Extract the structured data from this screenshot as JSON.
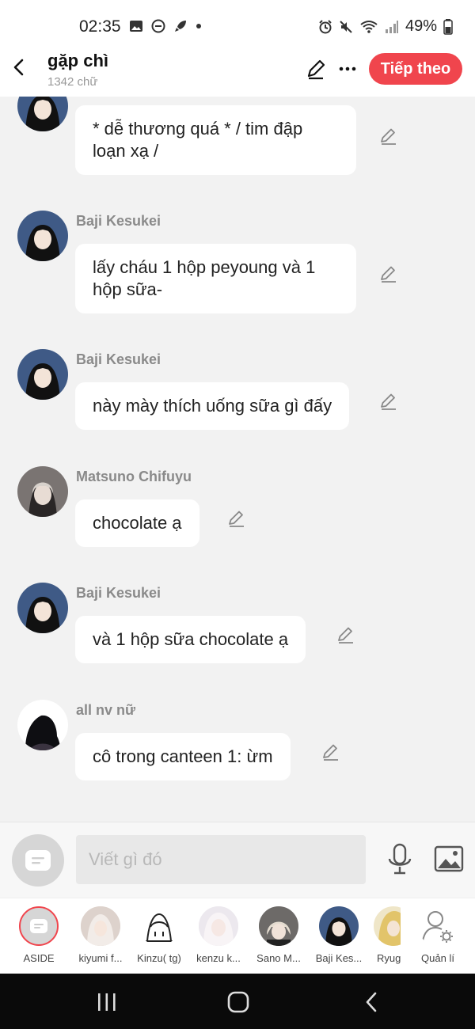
{
  "status_bar": {
    "time": "02:35",
    "battery": "49%"
  },
  "header": {
    "title": "gặp chì",
    "word_count": "1342 chữ",
    "next_label": "Tiếp theo"
  },
  "messages": [
    {
      "sender": "",
      "text": "* dễ thương quá * / tim đập loạn xạ /"
    },
    {
      "sender": "Baji Kesukei",
      "text": "lấy cháu 1 hộp peyoung và 1 hộp sữa-"
    },
    {
      "sender": "Baji Kesukei",
      "text": "này mày thích uống sữa gì đấy"
    },
    {
      "sender": "Matsuno Chifuyu",
      "text": "chocolate ạ"
    },
    {
      "sender": "Baji Kesukei",
      "text": "và 1 hộp sữa chocolate ạ"
    },
    {
      "sender": "all nv nữ",
      "text": "cô trong canteen 1: ừm"
    }
  ],
  "composer": {
    "placeholder": "Viết gì đó"
  },
  "characters": [
    {
      "label": "ASIDE"
    },
    {
      "label": "kiyumi f..."
    },
    {
      "label": "Kinzu( tg)"
    },
    {
      "label": "kenzu k..."
    },
    {
      "label": "Sano M..."
    },
    {
      "label": "Baji Kes..."
    },
    {
      "label": "Ryug"
    },
    {
      "label": "Quản lí"
    }
  ],
  "colors": {
    "accent": "#f0454d",
    "background": "#f2f2f2",
    "bubble": "#ffffff"
  },
  "icons": [
    "back-icon",
    "edit-icon",
    "more-icon",
    "pencil-icon",
    "aside-icon",
    "mic-icon",
    "image-icon",
    "manage-icon"
  ]
}
